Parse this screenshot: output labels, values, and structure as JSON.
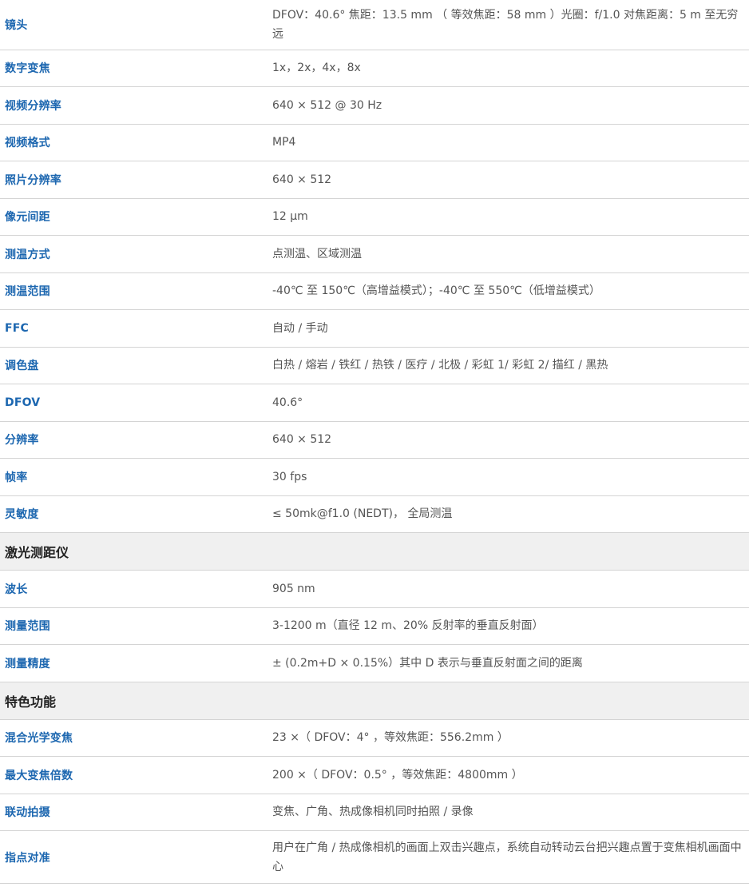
{
  "thermal_rows": [
    {
      "label": "镜头",
      "value": "DFOV：40.6° 焦距：13.5 mm （ 等效焦距：58 mm ）光圈：f/1.0 对焦距离：5 m 至无穷远"
    },
    {
      "label": "数字变焦",
      "value": "1x，2x，4x，8x"
    },
    {
      "label": "视频分辨率",
      "value": "640 × 512 @ 30 Hz"
    },
    {
      "label": "视频格式",
      "value": "MP4"
    },
    {
      "label": "照片分辨率",
      "value": "640 × 512"
    },
    {
      "label": "像元间距",
      "value": "12 μm"
    },
    {
      "label": "测温方式",
      "value": "点测温、区域测温"
    },
    {
      "label": "测温范围",
      "value": "-40℃ 至 150℃（高增益模式）；-40℃ 至 550℃（低增益模式）"
    },
    {
      "label": "FFC",
      "value": "自动 / 手动"
    },
    {
      "label": "调色盘",
      "value": "白热 / 熔岩 / 铁红 / 热铁 / 医疗 / 北极 / 彩虹 1/ 彩虹 2/ 描红 / 黑热"
    },
    {
      "label": "DFOV",
      "value": "40.6°"
    },
    {
      "label": "分辨率",
      "value": "640 × 512"
    },
    {
      "label": "帧率",
      "value": "30 fps"
    },
    {
      "label": "灵敏度",
      "value": "≤ 50mk@f1.0 (NEDT)， 全局测温"
    }
  ],
  "laser": {
    "title": "激光测距仪",
    "rows": [
      {
        "label": "波长",
        "value": "905 nm"
      },
      {
        "label": "测量范围",
        "value": "3-1200 m（直径 12 m、20% 反射率的垂直反射面）"
      },
      {
        "label": "测量精度",
        "value": "± (0.2m+D × 0.15%）其中 D 表示与垂直反射面之间的距离"
      }
    ]
  },
  "features": {
    "title": "特色功能",
    "rows": [
      {
        "label": "混合光学变焦",
        "value": "23 ×（ DFOV：4° ，等效焦距：556.2mm ）"
      },
      {
        "label": "最大变焦倍数",
        "value": "200 ×（ DFOV：0.5° ，等效焦距：4800mm ）"
      },
      {
        "label": "联动拍摄",
        "value": "变焦、广角、热成像相机同时拍照 / 录像"
      },
      {
        "label": "指点对准",
        "value": "用户在广角 / 热成像相机的画面上双击兴趣点，系统自动转动云台把兴趣点置于变焦相机画面中心"
      }
    ]
  }
}
